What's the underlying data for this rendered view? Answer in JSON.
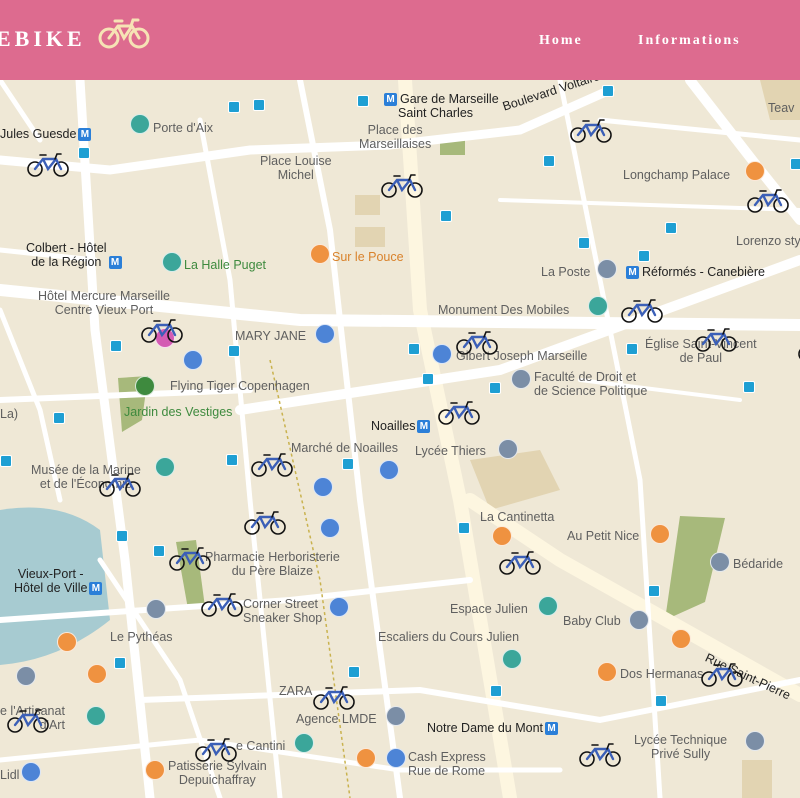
{
  "header": {
    "brand": "EBIKE",
    "nav": [
      {
        "label": "Home"
      },
      {
        "label": "Informations"
      }
    ],
    "colors": {
      "bar": "#dd6b8f",
      "logo": "#f6e3b5"
    }
  },
  "map": {
    "labels": [
      {
        "id": "jules-guesde",
        "text": "Jules Guesde",
        "metro": true
      },
      {
        "id": "porte-daix",
        "text": "Porte d'Aix"
      },
      {
        "id": "gare",
        "text": "Gare de Marseille\nSaint Charles",
        "metro": true
      },
      {
        "id": "bd-voltaire",
        "text": "Boulevard Voltaire"
      },
      {
        "id": "teav",
        "text": "Teav"
      },
      {
        "id": "place-marseillaises",
        "text": "Place des\nMarseillaises"
      },
      {
        "id": "place-louise",
        "text": "Place Louise\nMichel"
      },
      {
        "id": "longchamp",
        "text": "Longchamp Palace"
      },
      {
        "id": "colbert",
        "text": "Colbert - Hôtel\nde la Région",
        "metro": true
      },
      {
        "id": "halle-puget",
        "text": "La Halle Puget"
      },
      {
        "id": "sur-le-pouce",
        "text": "Sur le Pouce"
      },
      {
        "id": "lorenzo",
        "text": "Lorenzo styl"
      },
      {
        "id": "la-poste",
        "text": "La Poste"
      },
      {
        "id": "reformes",
        "text": "Réformés - Canebière",
        "metro": true
      },
      {
        "id": "hotel-mercure",
        "text": "Hôtel Mercure Marseille\nCentre Vieux Port"
      },
      {
        "id": "monument",
        "text": "Monument Des Mobiles"
      },
      {
        "id": "mary-jane",
        "text": "MARY JANE"
      },
      {
        "id": "eglise",
        "text": "Église Saint-Vincent\nde Paul"
      },
      {
        "id": "gibert",
        "text": "Gibert Joseph Marseille"
      },
      {
        "id": "faculte",
        "text": "Faculté de Droit et\nde Science Politique"
      },
      {
        "id": "flying-tiger",
        "text": "Flying Tiger Copenhagen"
      },
      {
        "id": "jardin",
        "text": "Jardin des Vestiges"
      },
      {
        "id": "la",
        "text": "La)"
      },
      {
        "id": "noailles",
        "text": "Noailles",
        "metro": true
      },
      {
        "id": "marche",
        "text": "Marché de Noailles"
      },
      {
        "id": "lycee-thiers",
        "text": "Lycée Thiers"
      },
      {
        "id": "musee-marine",
        "text": "Musée de la Marine\net de l'Économie"
      },
      {
        "id": "la-cantinetta",
        "text": "La Cantinetta"
      },
      {
        "id": "au-petit-nice",
        "text": "Au Petit Nice"
      },
      {
        "id": "pharmacie",
        "text": "Pharmacie Herboristerie\ndu Père Blaize"
      },
      {
        "id": "bedaride",
        "text": "Bédaride"
      },
      {
        "id": "vieux-port",
        "text": "Vieux-Port -\nHôtel de Ville",
        "metro": true
      },
      {
        "id": "corner-street",
        "text": "Corner Street\nSneaker Shop"
      },
      {
        "id": "espace-julien",
        "text": "Espace Julien"
      },
      {
        "id": "baby-club",
        "text": "Baby Club"
      },
      {
        "id": "le-pytheas",
        "text": "Le Pythéas"
      },
      {
        "id": "escaliers",
        "text": "Escaliers du Cours Julien"
      },
      {
        "id": "dos-hermanas",
        "text": "Dos Hermanas"
      },
      {
        "id": "rue-saint-pierre",
        "text": "Rue Saint-Pierre"
      },
      {
        "id": "zara",
        "text": "ZARA"
      },
      {
        "id": "artisanat",
        "text": "e l'Artisanat\nd'Art"
      },
      {
        "id": "agence-lmde",
        "text": "Agence LMDE"
      },
      {
        "id": "notre-dame",
        "text": "Notre Dame du Mont",
        "metro": true
      },
      {
        "id": "cantini",
        "text": "e Cantini"
      },
      {
        "id": "cash-express",
        "text": "Cash Express\nRue de Rome"
      },
      {
        "id": "lycee-tech",
        "text": "Lycée Technique\nPrivé Sully"
      },
      {
        "id": "patisserie",
        "text": "Patisserie Sylvain\nDepuichaffray"
      },
      {
        "id": "lidl",
        "text": "Lidl"
      }
    ],
    "bikes_count": 24,
    "colors": {
      "land": "#efe8d6",
      "roads": "#ffffff",
      "major_road": "#fdf6e0",
      "park": "#a7b97b",
      "water": "#a7cbd1",
      "bike": "#3b5fb7"
    }
  }
}
